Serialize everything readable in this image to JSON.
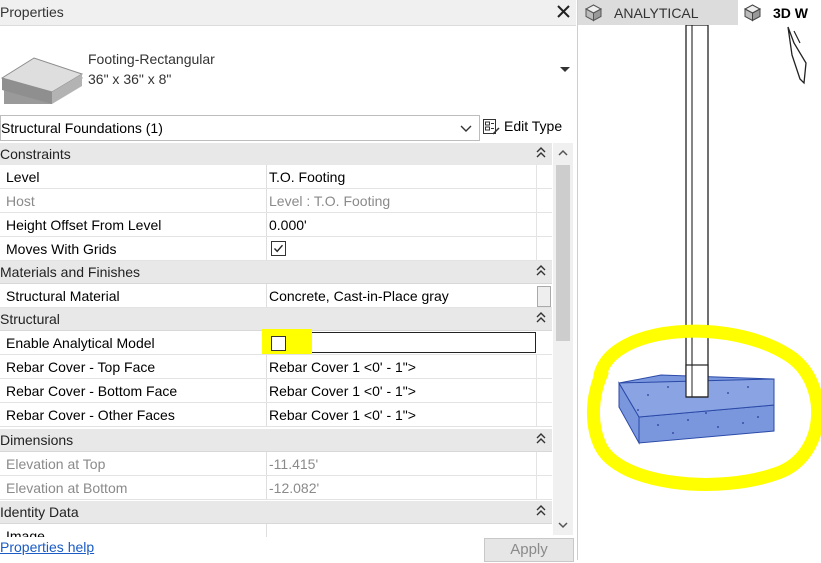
{
  "properties": {
    "title": "Properties",
    "type_name": "Footing-Rectangular",
    "type_size": "36\" x 36\" x 8\"",
    "selection": "Structural Foundations (1)",
    "edit_type": "Edit Type",
    "sections": {
      "constraints": "Constraints",
      "materials": "Materials and Finishes",
      "structural": "Structural",
      "dimensions": "Dimensions",
      "identity": "Identity Data"
    },
    "rows": {
      "level": {
        "name": "Level",
        "value": "T.O. Footing"
      },
      "host": {
        "name": "Host",
        "value": "Level : T.O. Footing"
      },
      "height_offset": {
        "name": "Height Offset From Level",
        "value": "0.000'"
      },
      "moves_with_grids": {
        "name": "Moves With Grids",
        "checked": true
      },
      "structural_material": {
        "name": "Structural Material",
        "value": "Concrete, Cast-in-Place gray"
      },
      "enable_analytical": {
        "name": "Enable Analytical Model",
        "checked": false
      },
      "rebar_top": {
        "name": "Rebar Cover - Top Face",
        "value": "Rebar Cover 1 <0' - 1\">"
      },
      "rebar_bottom": {
        "name": "Rebar Cover - Bottom Face",
        "value": "Rebar Cover 1 <0' - 1\">"
      },
      "rebar_other": {
        "name": "Rebar Cover - Other Faces",
        "value": "Rebar Cover 1 <0' - 1\">"
      },
      "elev_top": {
        "name": "Elevation at Top",
        "value": "-11.415'"
      },
      "elev_bottom": {
        "name": "Elevation at Bottom",
        "value": "-12.082'"
      },
      "image": {
        "name": "Image",
        "value": ""
      }
    },
    "help_link": "Properties help",
    "apply": "Apply"
  },
  "view_tabs": {
    "analytical": "ANALYTICAL",
    "three_d": "3D W"
  },
  "colors": {
    "highlight": "#ffff00",
    "footing_fill": "#7a97de",
    "link": "#1a5bc4"
  }
}
